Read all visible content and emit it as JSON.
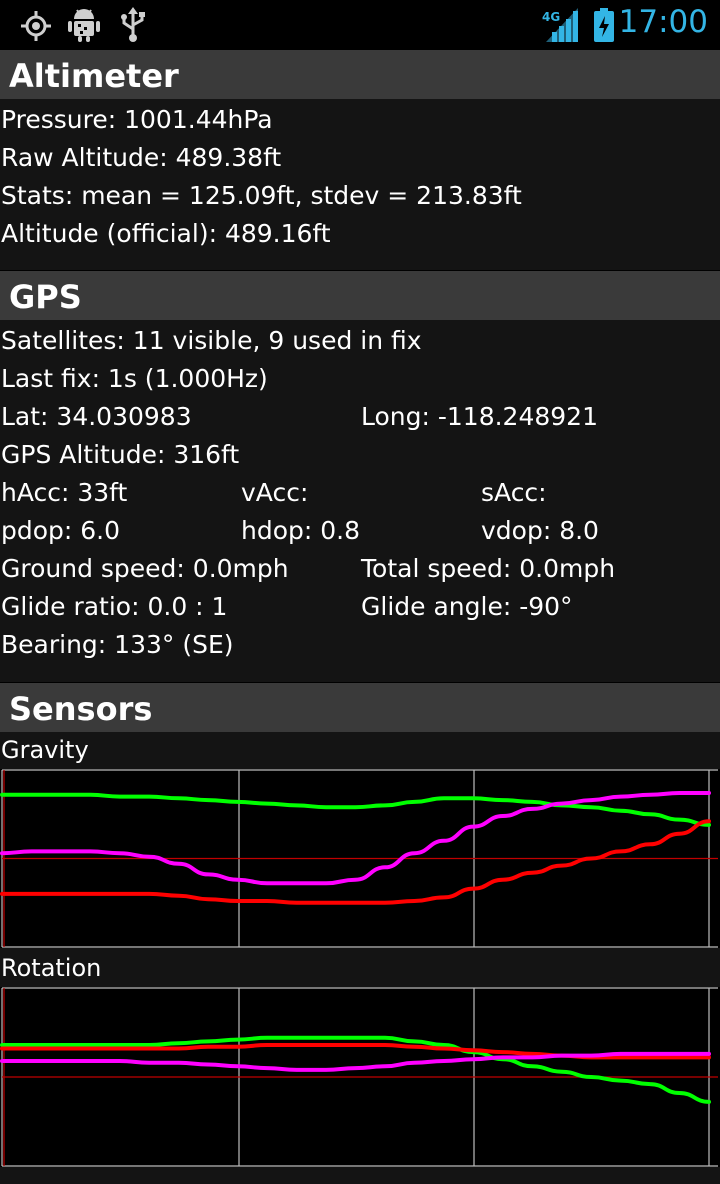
{
  "status_bar": {
    "icons": [
      "gps-icon",
      "android-debug-icon",
      "usb-icon",
      "signal-4g-icon",
      "battery-charging-icon"
    ],
    "network": "4G",
    "time": "17:00",
    "accent_color": "#33b5e5"
  },
  "altimeter": {
    "title": "Altimeter",
    "pressure": "Pressure: 1001.44hPa",
    "raw_altitude": "Raw Altitude: 489.38ft",
    "stats": "Stats: mean = 125.09ft, stdev = 213.83ft",
    "official": "Altitude (official): 489.16ft"
  },
  "gps": {
    "title": "GPS",
    "satellites": "Satellites: 11 visible, 9 used in fix",
    "last_fix": "Last fix: 1s (1.000Hz)",
    "lat": "Lat: 34.030983",
    "long": "Long: -118.248921",
    "gps_altitude": "GPS Altitude: 316ft",
    "hacc": "hAcc: 33ft",
    "vacc": "vAcc:",
    "sacc": "sAcc:",
    "pdop": "pdop: 6.0",
    "hdop": "hdop: 0.8",
    "vdop": "vdop: 8.0",
    "ground_speed": "Ground speed: 0.0mph",
    "total_speed": "Total speed: 0.0mph",
    "glide_ratio": "Glide ratio: 0.0 : 1",
    "glide_angle": "Glide angle: -90°",
    "bearing": "Bearing: 133° (SE)"
  },
  "sensors": {
    "title": "Sensors",
    "gravity": {
      "label": "Gravity",
      "series_colors": [
        "#00ff00",
        "#ff00ff",
        "#ff0000"
      ],
      "series": [
        {
          "color": "#00ff00",
          "values": [
            0.86,
            0.86,
            0.86,
            0.86,
            0.85,
            0.85,
            0.84,
            0.83,
            0.82,
            0.81,
            0.8,
            0.79,
            0.79,
            0.8,
            0.82,
            0.84,
            0.84,
            0.83,
            0.82,
            0.8,
            0.79,
            0.77,
            0.75,
            0.72,
            0.69
          ]
        },
        {
          "color": "#ff00ff",
          "values": [
            0.53,
            0.54,
            0.54,
            0.54,
            0.53,
            0.51,
            0.47,
            0.41,
            0.38,
            0.36,
            0.36,
            0.36,
            0.38,
            0.45,
            0.53,
            0.6,
            0.68,
            0.74,
            0.78,
            0.81,
            0.83,
            0.85,
            0.86,
            0.87,
            0.87
          ]
        },
        {
          "color": "#ff0000",
          "values": [
            0.3,
            0.3,
            0.3,
            0.3,
            0.3,
            0.3,
            0.29,
            0.27,
            0.26,
            0.26,
            0.25,
            0.25,
            0.25,
            0.25,
            0.26,
            0.28,
            0.33,
            0.38,
            0.42,
            0.46,
            0.5,
            0.54,
            0.58,
            0.64,
            0.71
          ]
        }
      ]
    },
    "rotation": {
      "label": "Rotation",
      "series_colors": [
        "#00ff00",
        "#ff0000",
        "#ff00ff"
      ],
      "series": [
        {
          "color": "#00ff00",
          "values": [
            0.68,
            0.68,
            0.68,
            0.68,
            0.68,
            0.68,
            0.69,
            0.7,
            0.71,
            0.72,
            0.72,
            0.72,
            0.72,
            0.72,
            0.7,
            0.68,
            0.64,
            0.6,
            0.56,
            0.53,
            0.5,
            0.48,
            0.46,
            0.41,
            0.36
          ]
        },
        {
          "color": "#ff0000",
          "values": [
            0.66,
            0.66,
            0.66,
            0.66,
            0.66,
            0.66,
            0.66,
            0.67,
            0.67,
            0.68,
            0.68,
            0.68,
            0.68,
            0.68,
            0.67,
            0.66,
            0.65,
            0.64,
            0.63,
            0.62,
            0.61,
            0.61,
            0.61,
            0.61,
            0.61
          ]
        },
        {
          "color": "#ff00ff",
          "values": [
            0.59,
            0.59,
            0.59,
            0.59,
            0.59,
            0.58,
            0.58,
            0.57,
            0.56,
            0.55,
            0.54,
            0.54,
            0.55,
            0.56,
            0.58,
            0.59,
            0.6,
            0.61,
            0.61,
            0.62,
            0.62,
            0.63,
            0.63,
            0.63,
            0.63
          ]
        }
      ]
    }
  }
}
